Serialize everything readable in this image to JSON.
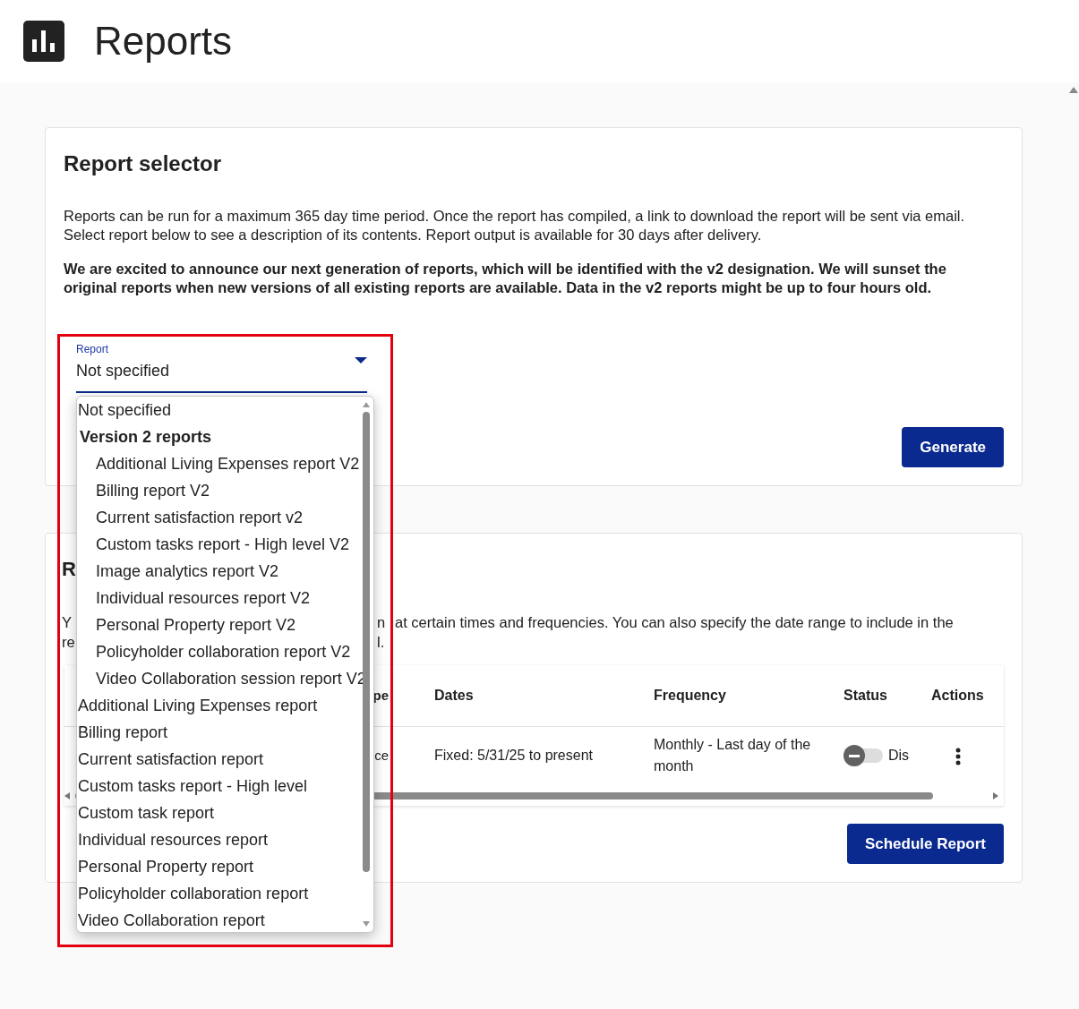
{
  "header": {
    "title": "Reports"
  },
  "report_selector": {
    "title": "Report selector",
    "description": "Reports can be run for a maximum 365 day time period. Once the report has compiled, a link to download the report will be sent via email. Select report below to see a description of its contents. Report output is available for 30 days after delivery.",
    "announcement": "We are excited to announce our next generation of reports, which will be identified with the v2 designation. We will sunset the original reports when new versions of all existing reports are available. Data in the v2 reports might be up to four hours old.",
    "field": {
      "label": "Report",
      "value": "Not specified",
      "expanded": true
    },
    "options": [
      {
        "kind": "option",
        "label": "Not specified"
      },
      {
        "kind": "group",
        "label": "Version 2 reports",
        "children": [
          "Additional Living Expenses report V2",
          "Billing report V2",
          "Current satisfaction report v2",
          "Custom tasks report - High level V2",
          "Image analytics report V2",
          "Individual resources report V2",
          "Personal Property report V2",
          "Policyholder collaboration report V2",
          "Video Collaboration session report V2"
        ]
      },
      {
        "kind": "option",
        "label": "Additional Living Expenses report"
      },
      {
        "kind": "option",
        "label": "Billing report"
      },
      {
        "kind": "option",
        "label": "Current satisfaction report"
      },
      {
        "kind": "option",
        "label": "Custom tasks report - High level"
      },
      {
        "kind": "option",
        "label": "Custom task report"
      },
      {
        "kind": "option",
        "label": "Individual resources report"
      },
      {
        "kind": "option",
        "label": "Personal Property report"
      },
      {
        "kind": "option",
        "label": "Policyholder collaboration report"
      },
      {
        "kind": "option",
        "label": "Video Collaboration report"
      }
    ],
    "button": "Generate"
  },
  "scheduled": {
    "title": "R",
    "lines": [
      {
        "left": "Y",
        "middle": "n",
        "right": "at certain times and frequencies. You can also specify the date range to include in the"
      },
      {
        "left": "re",
        "middle": "l."
      }
    ],
    "table": {
      "columns": [
        "pe",
        "Dates",
        "Frequency",
        "Status",
        "Actions"
      ],
      "rows": [
        {
          "column_1": "ce",
          "dates": "Fixed: 5/31/25 to present",
          "frequency": "Monthly - Last day of the month",
          "status": {
            "on": false,
            "label": "Dis"
          }
        }
      ]
    },
    "button": "Schedule Report"
  }
}
